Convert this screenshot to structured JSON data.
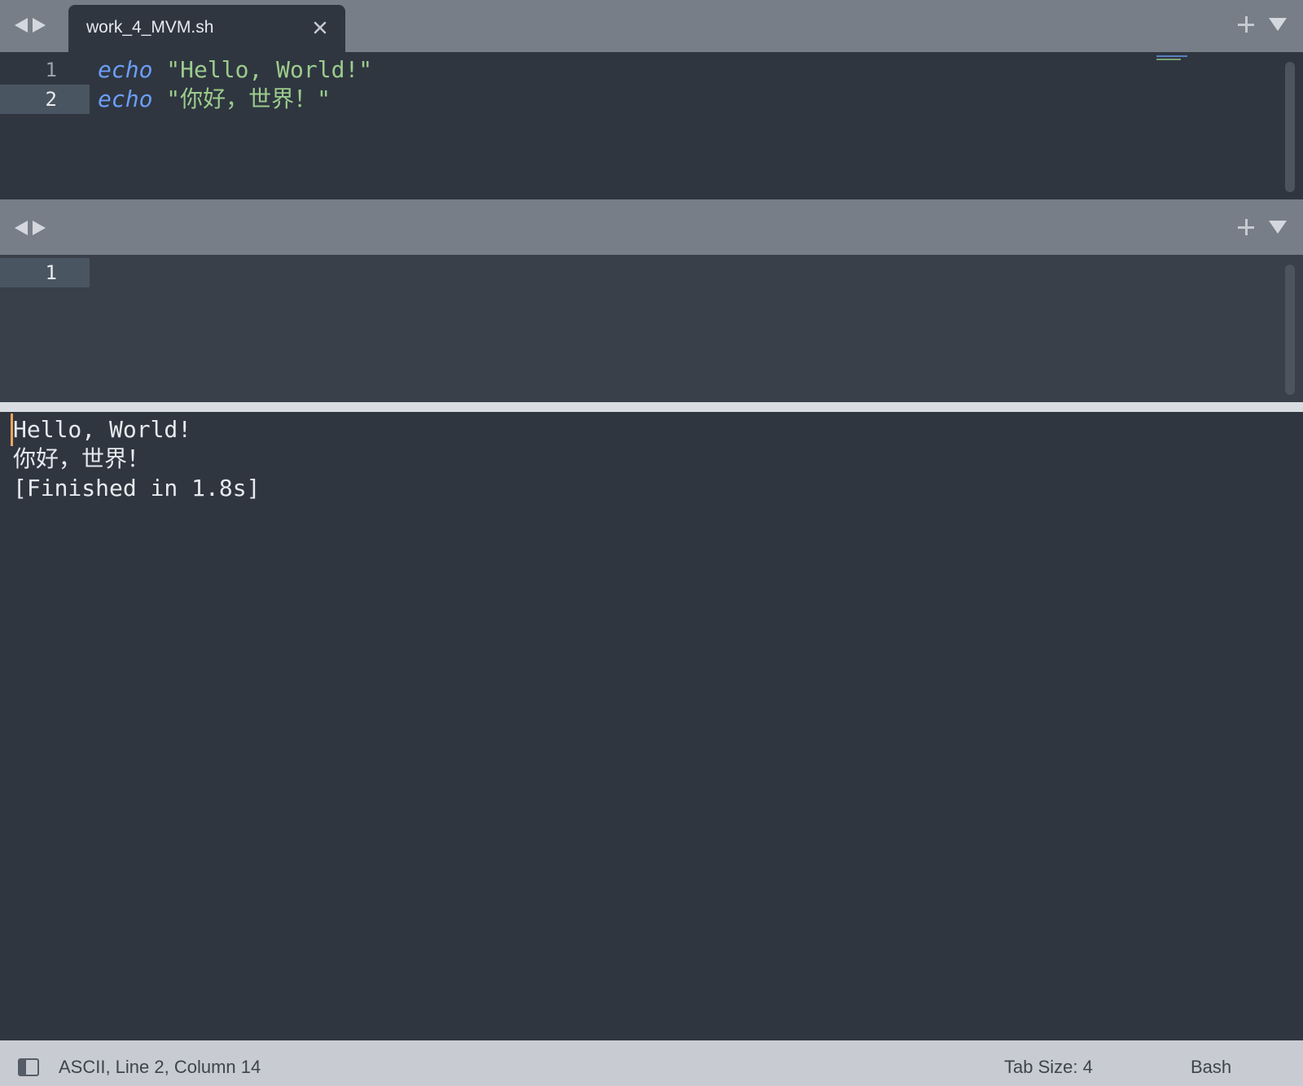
{
  "tabs": [
    {
      "title": "work_4_MVM.sh"
    }
  ],
  "editor_top": {
    "lines": [
      {
        "number": "1",
        "keyword": "echo",
        "string": "\"Hello, World!\""
      },
      {
        "number": "2",
        "keyword": "echo",
        "string": "\"你好，世界！\""
      }
    ]
  },
  "editor_bottom": {
    "lines": [
      {
        "number": "1"
      }
    ]
  },
  "output": {
    "lines": [
      "Hello, World!",
      "你好，世界！",
      "[Finished in 1.8s]"
    ]
  },
  "status": {
    "position": "ASCII, Line 2, Column 14",
    "tab_size": "Tab Size: 4",
    "syntax": "Bash"
  },
  "colors": {
    "keyword": "#6c9ef8",
    "string": "#9ccc8c",
    "background": "#2f3640",
    "cursor": "#f0a45a"
  }
}
